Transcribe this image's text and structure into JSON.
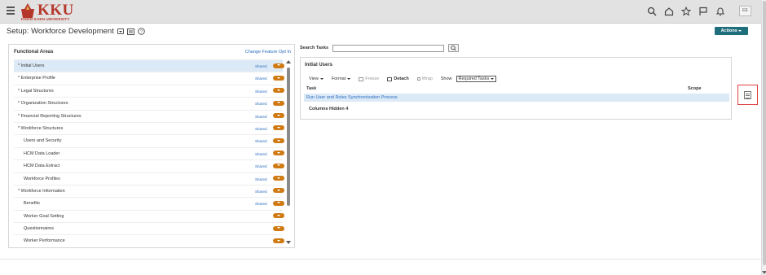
{
  "header": {
    "logo_text": "KKU",
    "logo_subtext": "KHON KAEN UNIVERSITY",
    "user_initials": "EE",
    "icons": [
      "search-icon",
      "home-icon",
      "star-icon",
      "flag-icon",
      "bell-icon"
    ]
  },
  "page": {
    "title": "Setup: Workforce Development",
    "actions_label": "Actions"
  },
  "functional_areas": {
    "title": "Functional Areas",
    "change_link": "Change Feature Opt In",
    "shared_label": "Shared",
    "items": [
      {
        "label": "Initial Users",
        "required": true,
        "shared": true,
        "selected": true
      },
      {
        "label": "Enterprise Profile",
        "required": true,
        "shared": true,
        "selected": false
      },
      {
        "label": "Legal Structures",
        "required": true,
        "shared": true,
        "selected": false
      },
      {
        "label": "Organization Structures",
        "required": true,
        "shared": true,
        "selected": false
      },
      {
        "label": "Financial Reporting Structures",
        "required": true,
        "shared": true,
        "selected": false
      },
      {
        "label": "Workforce Structures",
        "required": true,
        "shared": true,
        "selected": false
      },
      {
        "label": "Users and Security",
        "required": false,
        "shared": true,
        "selected": false
      },
      {
        "label": "HCM Data Loader",
        "required": false,
        "shared": true,
        "selected": false
      },
      {
        "label": "HCM Data Extract",
        "required": false,
        "shared": true,
        "selected": false
      },
      {
        "label": "Workforce Profiles",
        "required": false,
        "shared": true,
        "selected": false
      },
      {
        "label": "Workforce Information",
        "required": true,
        "shared": true,
        "selected": false
      },
      {
        "label": "Benefits",
        "required": false,
        "shared": true,
        "selected": false
      },
      {
        "label": "Worker Goal Setting",
        "required": false,
        "shared": false,
        "selected": false
      },
      {
        "label": "Questionnaires",
        "required": false,
        "shared": false,
        "selected": false
      },
      {
        "label": "Worker Performance",
        "required": false,
        "shared": false,
        "selected": false
      }
    ]
  },
  "search": {
    "label": "Search Tasks",
    "value": ""
  },
  "tasks_panel": {
    "title": "Initial Users",
    "toolbar": {
      "view": "View",
      "format": "Format",
      "freeze": "Freeze",
      "detach": "Detach",
      "wrap": "Wrap",
      "show_label": "Show",
      "show_value": "Required Tasks"
    },
    "columns": {
      "task": "Task",
      "scope": "Scope"
    },
    "rows": [
      {
        "task": "Run User and Roles Synchronization Process",
        "scope": ""
      }
    ],
    "columns_hidden": "Columns Hidden 4"
  }
}
